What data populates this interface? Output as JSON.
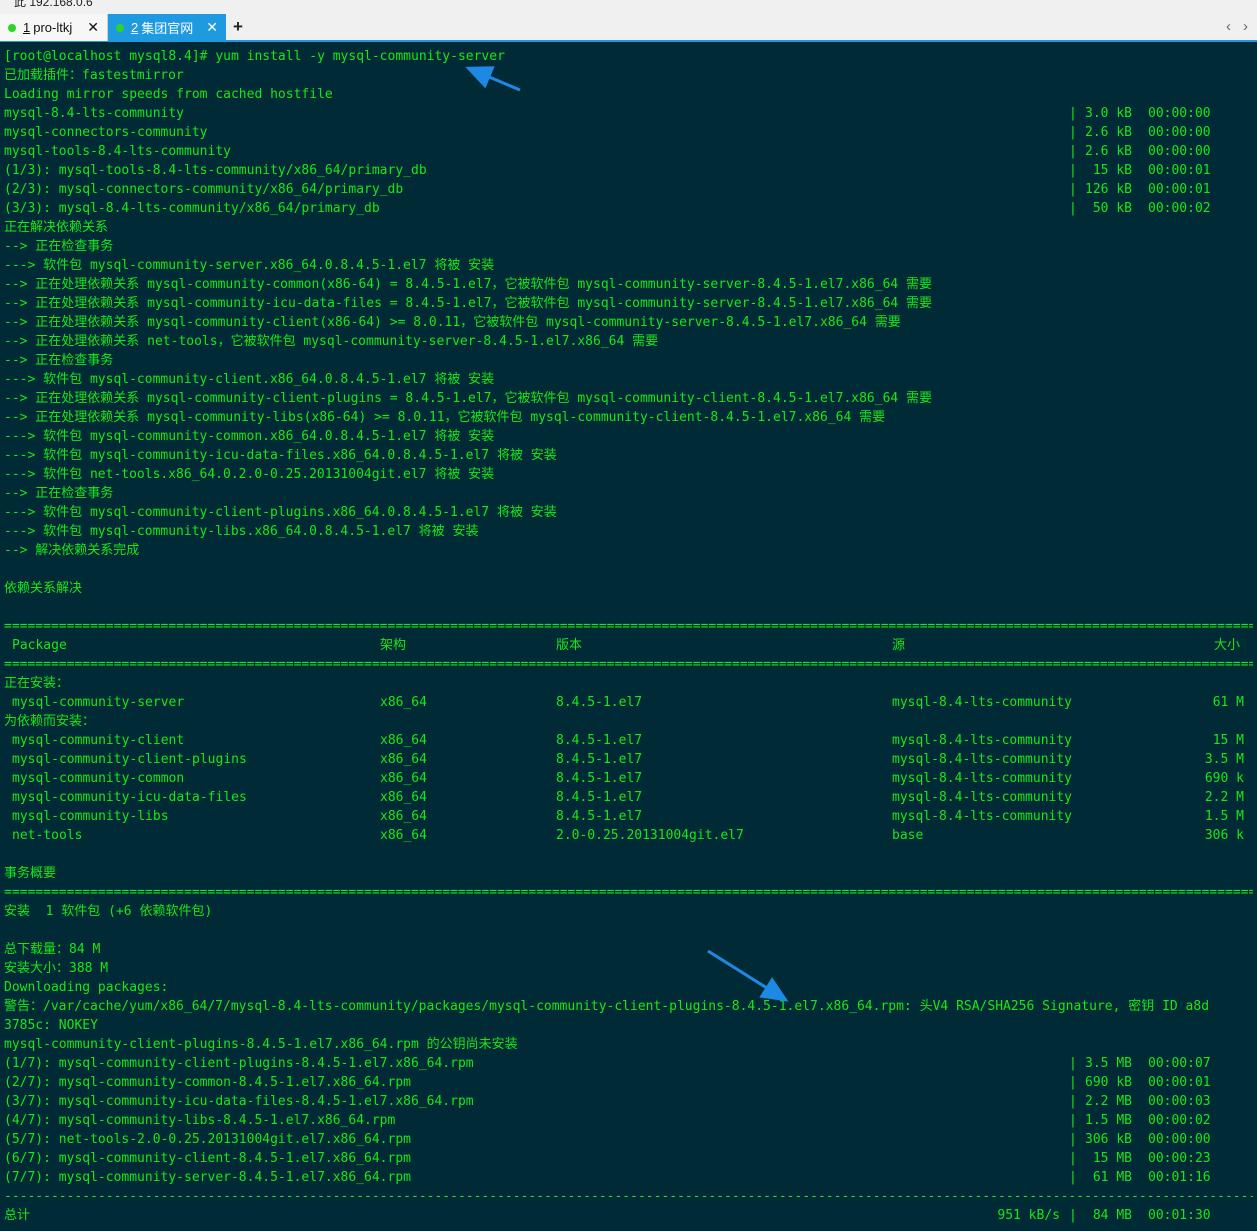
{
  "window": {
    "top_text": "此   192.168.0.6"
  },
  "tabs": [
    {
      "number": "1",
      "label": "pro-ltkj",
      "close": "✕"
    },
    {
      "number": "2",
      "label": "集团官网",
      "close": "✕"
    }
  ],
  "tab_add": "+",
  "nav": {
    "left": "‹",
    "right": "›"
  },
  "colors": {
    "terminal_bg": "#002b36",
    "terminal_fg": "#19e619",
    "tab_active": "#1e9be0",
    "status_dot": "#2bd42b",
    "annotation_arrow": "#1e88e5"
  },
  "terminal": {
    "command_lines": [
      "[root@localhost mysql8.4]# yum install -y mysql-community-server",
      "已加载插件：fastestmirror",
      "Loading mirror speeds from cached hostfile"
    ],
    "repo_lines": [
      {
        "name": "mysql-8.4-lts-community",
        "size": "3.0 kB",
        "time": "00:00:00"
      },
      {
        "name": "mysql-connectors-community",
        "size": "2.6 kB",
        "time": "00:00:00"
      },
      {
        "name": "mysql-tools-8.4-lts-community",
        "size": "2.6 kB",
        "time": "00:00:00"
      },
      {
        "name": "(1/3): mysql-tools-8.4-lts-community/x86_64/primary_db",
        "size": " 15 kB",
        "time": "00:00:01"
      },
      {
        "name": "(2/3): mysql-connectors-community/x86_64/primary_db",
        "size": "126 kB",
        "time": "00:00:01"
      },
      {
        "name": "(3/3): mysql-8.4-lts-community/x86_64/primary_db",
        "size": " 50 kB",
        "time": "00:00:02"
      }
    ],
    "dependency_lines": [
      "正在解决依赖关系",
      "--> 正在检查事务",
      "---> 软件包 mysql-community-server.x86_64.0.8.4.5-1.el7 将被 安装",
      "--> 正在处理依赖关系 mysql-community-common(x86-64) = 8.4.5-1.el7，它被软件包 mysql-community-server-8.4.5-1.el7.x86_64 需要",
      "--> 正在处理依赖关系 mysql-community-icu-data-files = 8.4.5-1.el7，它被软件包 mysql-community-server-8.4.5-1.el7.x86_64 需要",
      "--> 正在处理依赖关系 mysql-community-client(x86-64) >= 8.0.11，它被软件包 mysql-community-server-8.4.5-1.el7.x86_64 需要",
      "--> 正在处理依赖关系 net-tools，它被软件包 mysql-community-server-8.4.5-1.el7.x86_64 需要",
      "--> 正在检查事务",
      "---> 软件包 mysql-community-client.x86_64.0.8.4.5-1.el7 将被 安装",
      "--> 正在处理依赖关系 mysql-community-client-plugins = 8.4.5-1.el7，它被软件包 mysql-community-client-8.4.5-1.el7.x86_64 需要",
      "--> 正在处理依赖关系 mysql-community-libs(x86-64) >= 8.0.11，它被软件包 mysql-community-client-8.4.5-1.el7.x86_64 需要",
      "---> 软件包 mysql-community-common.x86_64.0.8.4.5-1.el7 将被 安装",
      "---> 软件包 mysql-community-icu-data-files.x86_64.0.8.4.5-1.el7 将被 安装",
      "---> 软件包 net-tools.x86_64.0.2.0-0.25.20131004git.el7 将被 安装",
      "--> 正在检查事务",
      "---> 软件包 mysql-community-client-plugins.x86_64.0.8.4.5-1.el7 将被 安装",
      "---> 软件包 mysql-community-libs.x86_64.0.8.4.5-1.el7 将被 安装",
      "--> 解决依赖关系完成"
    ],
    "resolved_line": "依赖关系解决",
    "table": {
      "headers": {
        "package": "Package",
        "arch": "架构",
        "version": "版本",
        "repo": "源",
        "size": "大小"
      },
      "installing_label": "正在安装：",
      "installing": [
        {
          "package": "mysql-community-server",
          "arch": "x86_64",
          "version": "8.4.5-1.el7",
          "repo": "mysql-8.4-lts-community",
          "size": "61 M"
        }
      ],
      "deps_label": "为依赖而安装：",
      "deps": [
        {
          "package": "mysql-community-client",
          "arch": "x86_64",
          "version": "8.4.5-1.el7",
          "repo": "mysql-8.4-lts-community",
          "size": "15 M"
        },
        {
          "package": "mysql-community-client-plugins",
          "arch": "x86_64",
          "version": "8.4.5-1.el7",
          "repo": "mysql-8.4-lts-community",
          "size": "3.5 M"
        },
        {
          "package": "mysql-community-common",
          "arch": "x86_64",
          "version": "8.4.5-1.el7",
          "repo": "mysql-8.4-lts-community",
          "size": "690 k"
        },
        {
          "package": "mysql-community-icu-data-files",
          "arch": "x86_64",
          "version": "8.4.5-1.el7",
          "repo": "mysql-8.4-lts-community",
          "size": "2.2 M"
        },
        {
          "package": "mysql-community-libs",
          "arch": "x86_64",
          "version": "8.4.5-1.el7",
          "repo": "mysql-8.4-lts-community",
          "size": "1.5 M"
        },
        {
          "package": "net-tools",
          "arch": "x86_64",
          "version": "2.0-0.25.20131004git.el7",
          "repo": "base",
          "size": "306 k"
        }
      ]
    },
    "summary_label": "事务概要",
    "summary_install": "安装  1 软件包 (+6 依赖软件包)",
    "total_download": "总下载量：84 M",
    "install_size": "安装大小：388 M",
    "downloading": "Downloading packages:",
    "warning_line1": "警告：/var/cache/yum/x86_64/7/mysql-8.4-lts-community/packages/mysql-community-client-plugins-8.4.5-1.el7.x86_64.rpm: 头V4 RSA/SHA256 Signature, 密钥 ID a8d",
    "warning_line2": "3785c: NOKEY",
    "pubkey_line": "mysql-community-client-plugins-8.4.5-1.el7.x86_64.rpm 的公钥尚未安装",
    "download_lines": [
      {
        "name": "(1/7): mysql-community-client-plugins-8.4.5-1.el7.x86_64.rpm",
        "size": "3.5 MB",
        "time": "00:00:07"
      },
      {
        "name": "(2/7): mysql-community-common-8.4.5-1.el7.x86_64.rpm",
        "size": "690 kB",
        "time": "00:00:01"
      },
      {
        "name": "(3/7): mysql-community-icu-data-files-8.4.5-1.el7.x86_64.rpm",
        "size": "2.2 MB",
        "time": "00:00:03"
      },
      {
        "name": "(4/7): mysql-community-libs-8.4.5-1.el7.x86_64.rpm",
        "size": "1.5 MB",
        "time": "00:00:02"
      },
      {
        "name": "(5/7): net-tools-2.0-0.25.20131004git.el7.x86_64.rpm",
        "size": "306 kB",
        "time": "00:00:00"
      },
      {
        "name": "(6/7): mysql-community-client-8.4.5-1.el7.x86_64.rpm",
        "size": " 15 MB",
        "time": "00:00:23"
      },
      {
        "name": "(7/7): mysql-community-server-8.4.5-1.el7.x86_64.rpm",
        "size": " 61 MB",
        "time": "00:01:16"
      }
    ],
    "total": {
      "label": "总计",
      "rate": "951 kB/s",
      "size": " 84 MB",
      "time": "00:01:30"
    }
  }
}
